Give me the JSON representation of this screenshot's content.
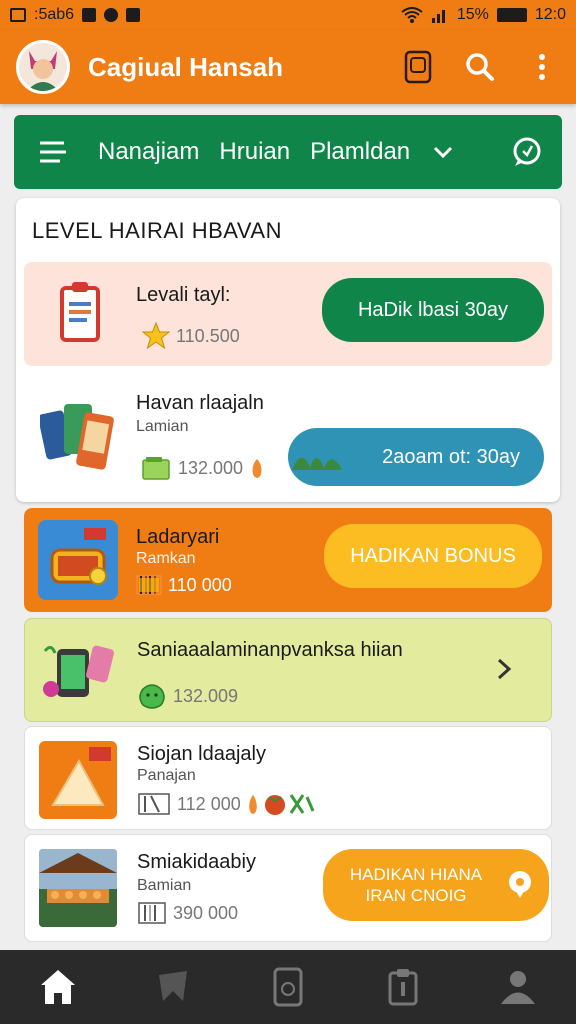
{
  "status_bar": {
    "left_text": ":5ab6",
    "battery": "15%",
    "time": "12:0"
  },
  "app_bar": {
    "title": "Cagiual Hansah"
  },
  "category_bar": {
    "tabs": [
      "Nanajiam",
      "Hruian",
      "Plamldan"
    ]
  },
  "section": {
    "title": "LEVEL HAIRAI HBAVAN"
  },
  "cards": [
    {
      "name": "Levali tayl:",
      "value": "110.500",
      "button": "HaDik lbasi 30ay"
    },
    {
      "name": "Havan rlaajaln",
      "sub": "Lamian",
      "value": "132.000",
      "button": "2aoam ot: 30ay"
    },
    {
      "name": "Ladaryari",
      "sub": "Ramkan",
      "value": "110 000",
      "button": "HADIKAN BONUS"
    },
    {
      "name": "Saniaaalaminanpvanksa hiian",
      "value": "132.009"
    },
    {
      "name": "Siojan ldaajaly",
      "sub": "Panajan",
      "value": "112 000"
    },
    {
      "name": "Smiakidaabiy",
      "sub": "Bamian",
      "value": "390 000",
      "button_line1": "HADIKAN HIANA",
      "button_line2": "IRAN CNOIG"
    }
  ],
  "colors": {
    "orange": "#f07d14",
    "green": "#10854a",
    "teal": "#2f93b6",
    "yellow": "#fbbd21",
    "dark_nav": "#2a2a2a"
  },
  "icons": [
    "image-icon",
    "gallery-icon",
    "settings-icon",
    "wifi-icon",
    "signal-icon",
    "battery-icon",
    "book-icon",
    "search-icon",
    "more-vert-icon",
    "menu-icon",
    "chevron-down-icon",
    "chat-icon",
    "clipboard-icon",
    "star-icon",
    "phones-icon",
    "wallet-icon",
    "treasure-icon",
    "phone-gift-icon",
    "coin-icon",
    "cheese-icon",
    "market-icon",
    "barcode-icon",
    "arrow-right-icon",
    "home-icon",
    "bookmark-icon",
    "phone-icon",
    "profile-icon"
  ]
}
